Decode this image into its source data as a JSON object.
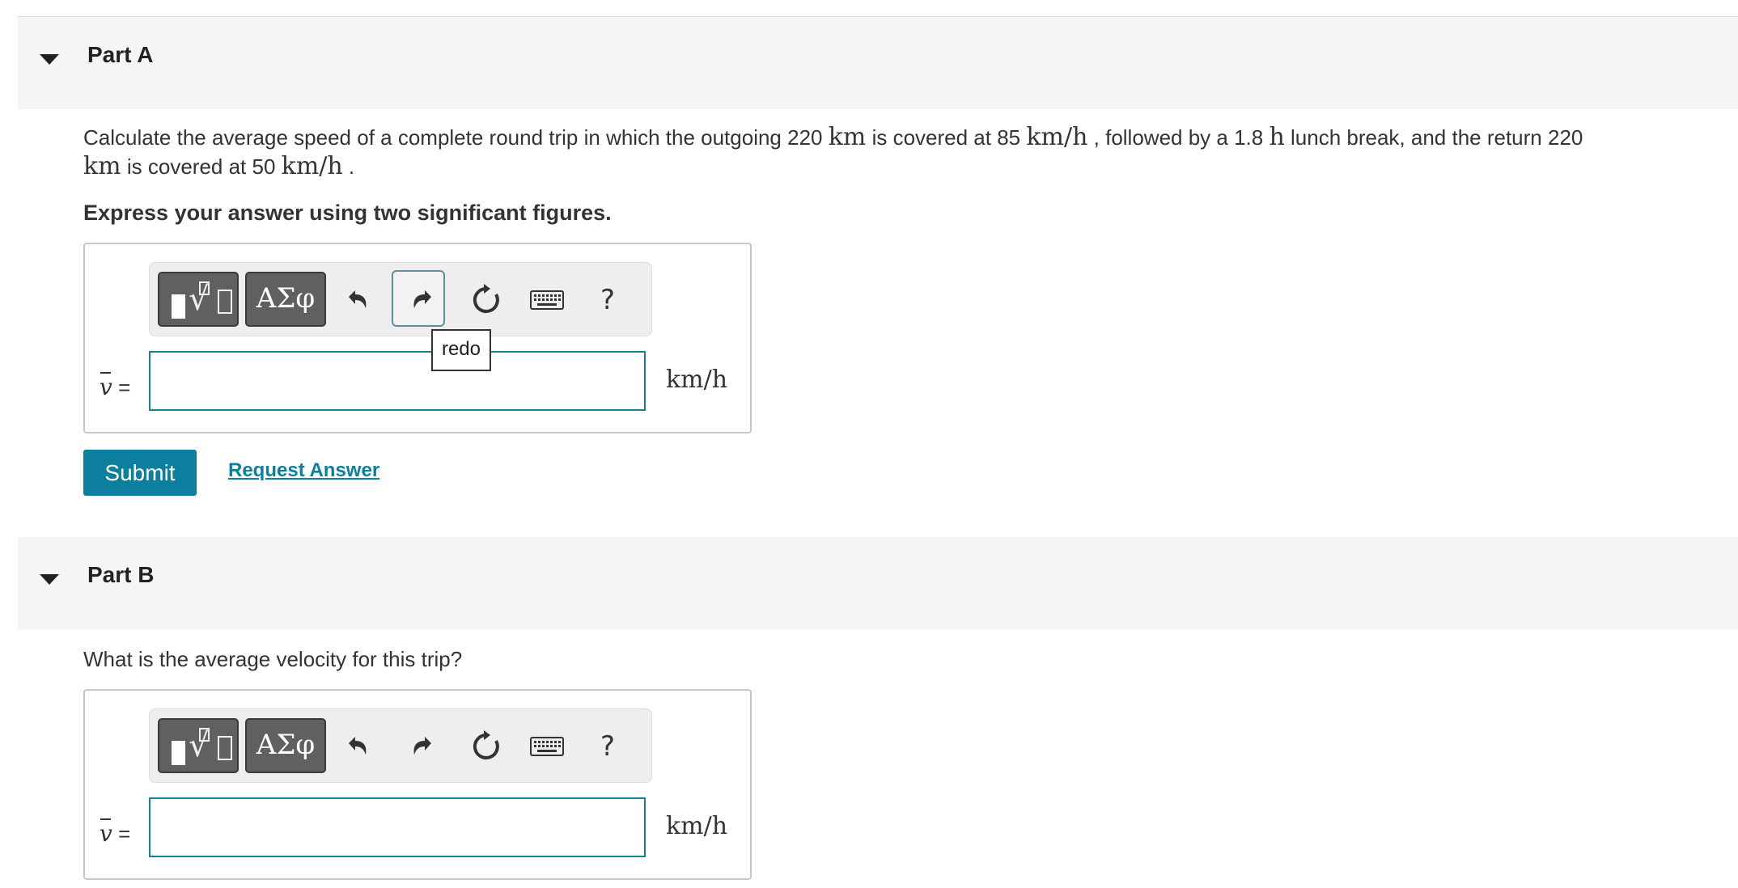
{
  "parts": [
    {
      "title": "Part A",
      "question": {
        "t1": "Calculate the average speed of a complete round trip in which the outgoing 220 ",
        "u1": "km",
        "t2": " is covered at 85 ",
        "u2": "km/h",
        "t3": " , followed by a 1.8 ",
        "u3": "h",
        "t4": " lunch break, and the return 220 ",
        "u4": "km",
        "t5": " is covered at 50 ",
        "u5": "km/h",
        "t6": " ."
      },
      "instruction": "Express your answer using two significant figures.",
      "variable": "v",
      "equals": "=",
      "unit": "km/h",
      "tooltip": "redo",
      "submit_label": "Submit",
      "request_label": "Request Answer"
    },
    {
      "title": "Part B",
      "question": "What is the average velocity for this trip?",
      "variable": "v",
      "equals": "=",
      "unit": "km/h"
    }
  ],
  "toolbar": {
    "greek_label": "ΑΣφ",
    "help_label": "?",
    "icons": [
      "templates-icon",
      "greek-letters-icon",
      "undo-icon",
      "redo-icon",
      "reset-icon",
      "keyboard-icon",
      "help-icon"
    ]
  },
  "colors": {
    "accent": "#0d7f9e",
    "input_border": "#1a7f94",
    "header_bg": "#f5f5f5",
    "toolbar_btn": "#606060"
  }
}
